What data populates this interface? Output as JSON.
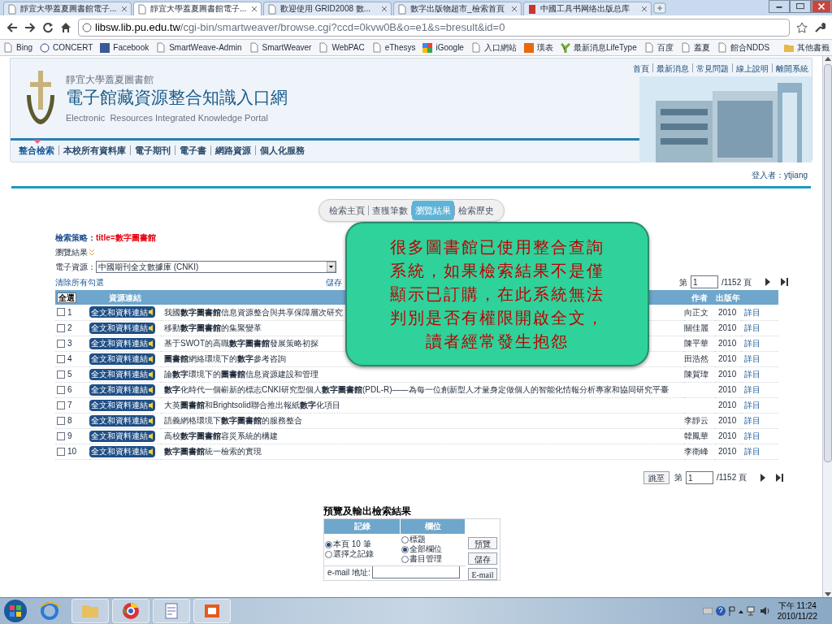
{
  "browser": {
    "tabs": [
      {
        "title": "靜宜大學蓋夏圖書館電子...",
        "selected": false
      },
      {
        "title": "靜宜大學蓋夏圖書館電子...",
        "selected": true
      },
      {
        "title": "歡迎使用 GRID2008 數...",
        "selected": false
      },
      {
        "title": "數字出版物超市_檢索首頁",
        "selected": false
      },
      {
        "title": "中國工具书网络出版总库",
        "selected": false
      }
    ],
    "url_host": "libsw.lib.pu.edu.tw",
    "url_path": "/cgi-bin/smartweaver/browse.cgi?ccd=0kvw0B&o=e1&s=bresult&id=0",
    "bookmarks": [
      "Bing",
      "CONCERT",
      "Facebook",
      "SmartWeave-Admin",
      "SmartWeaver",
      "WebPAC",
      "eThesys",
      "iGoogle",
      "入口網站",
      "璞表",
      "最新消息LifeType",
      "百度",
      "蓋夏",
      "館合NDDS"
    ],
    "other_bookmarks": "其他書籤"
  },
  "header": {
    "library": "靜宜大學蓋夏圖書館",
    "title": "電子館藏資源整合知識入口網",
    "subtitle": "Electronic  Resources Integrated Knowledge Portal",
    "top_links": [
      "首頁",
      "最新消息",
      "常見問題",
      "線上說明",
      "離開系統"
    ],
    "nav": [
      {
        "label": "整合檢索",
        "selected": true
      },
      {
        "label": "本校所有資料庫",
        "selected": false
      },
      {
        "label": "電子期刊",
        "selected": false
      },
      {
        "label": "電子書",
        "selected": false
      },
      {
        "label": "網路資源",
        "selected": false
      },
      {
        "label": "個人化服務",
        "selected": false
      }
    ],
    "login": "登入者：ytjiang"
  },
  "view_tabs": [
    {
      "label": "檢索主頁",
      "selected": false
    },
    {
      "label": "查獲筆數",
      "selected": false
    },
    {
      "label": "瀏覽結果",
      "selected": true
    },
    {
      "label": "檢索歷史",
      "selected": false
    }
  ],
  "search": {
    "strategy_label": "檢索策略：",
    "strategy_value": "title=數字圖書館",
    "browse": "瀏覽結果",
    "resource_label": "電子資源：",
    "resource_value": "中國期刊全文數據庫 (CNKI)",
    "clear": "清除所有勾選",
    "save": "儲存"
  },
  "pager_top": {
    "page_prefix": "第",
    "page": "1",
    "total": "/1152 頁"
  },
  "table": {
    "columns": [
      "全選",
      "資源連結",
      "作者",
      "出版年"
    ],
    "rows": [
      {
        "checked": false,
        "number": "1",
        "link": "全文和資料連結",
        "title": "我國**數字圖書館**信息資源整合與共享保障層次研究",
        "author": "向正文",
        "year": "2010",
        "detail": "詳目"
      },
      {
        "checked": false,
        "number": "2",
        "link": "全文和資料連結",
        "title": "移動**數字圖書館**的集聚變革",
        "author": "關佳麗",
        "year": "2010",
        "detail": "詳目"
      },
      {
        "checked": false,
        "number": "3",
        "link": "全文和資料連結",
        "title": "基于SWOT的高職**數字圖書館**發展策略初探",
        "author": "陳平華",
        "year": "2010",
        "detail": "詳目"
      },
      {
        "checked": false,
        "number": "4",
        "link": "全文和資料連結",
        "title": "**圖書館**網絡環境下的**數字**參考咨詢",
        "author": "田浩然",
        "year": "2010",
        "detail": "詳目"
      },
      {
        "checked": false,
        "number": "5",
        "link": "全文和資料連結",
        "title": "論**數字**環境下的**圖書館**信息資源建設和管理",
        "author": "陳賀瑋",
        "year": "2010",
        "detail": "詳目"
      },
      {
        "checked": false,
        "number": "6",
        "link": "全文和資料連結",
        "title": "**數字**化時代一個嶄新的標志CNKI研究型個人**數字圖書館**(PDL-R)——為每一位創新型人才量身定做個人的智能化情報分析專家和協同研究平臺",
        "year": "2010",
        "detail": "詳目"
      },
      {
        "checked": false,
        "number": "7",
        "link": "全文和資料連結",
        "title": "大英**圖書館**和Brightsolid聯合推出報紙**數字**化項目",
        "year": "2010",
        "detail": "詳目"
      },
      {
        "checked": false,
        "number": "8",
        "link": "全文和資料連結",
        "title": "語義網格環境下**數字圖書館**的服務整合",
        "author": "李靜云",
        "year": "2010",
        "detail": "詳目"
      },
      {
        "checked": false,
        "number": "9",
        "link": "全文和資料連結",
        "title": "高校**數字圖書館**容災系統的構建",
        "author": "韓鳳華",
        "year": "2010",
        "detail": "詳目"
      },
      {
        "checked": false,
        "number": "10",
        "link": "全文和資料連結",
        "title": "**數字圖書館**統一檢索的實現",
        "author": "李衛峰",
        "year": "2010",
        "detail": "詳目"
      }
    ]
  },
  "pager_bottom": {
    "goto": "跳至",
    "page_prefix": "第",
    "page": "1",
    "total": "/1152 頁"
  },
  "export": {
    "title": "預覽及輸出檢索結果",
    "headers": [
      "記錄",
      "欄位"
    ],
    "records": [
      {
        "label": "本頁 10 筆",
        "selected": true
      },
      {
        "label": "選擇之記錄",
        "selected": false
      }
    ],
    "fields": [
      {
        "label": "標題",
        "selected": false
      },
      {
        "label": "全部欄位",
        "selected": true
      },
      {
        "label": "書目管理",
        "selected": false
      }
    ],
    "buttons": [
      "預覽",
      "儲存",
      "E-mail"
    ],
    "email_label": "e-mail 地址:"
  },
  "callout": "很多圖書館已使用整合查詢系統，如果檢索結果不是僅顯示已訂購，在此系統無法判別是否有權限開啟全文，讀者經常發生抱怨",
  "taskbar": {
    "time": "下午 11:24",
    "date": "2010/11/22"
  }
}
